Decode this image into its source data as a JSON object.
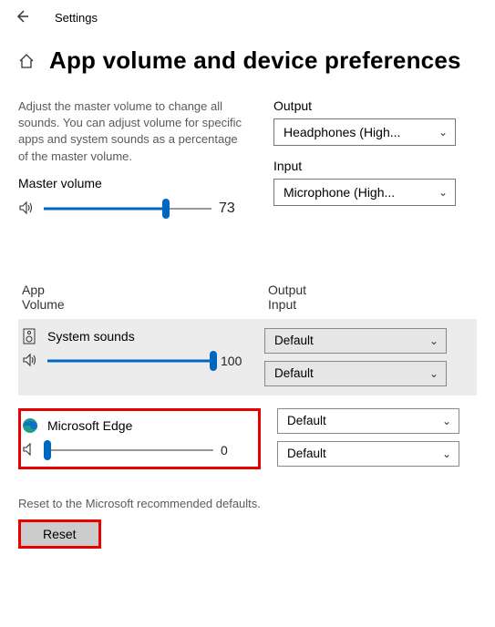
{
  "topbar": {
    "settings": "Settings"
  },
  "page_title": "App volume and device preferences",
  "description": "Adjust the master volume to change all sounds. You can adjust volume for specific apps and system sounds as a percentage of the master volume.",
  "output": {
    "label": "Output",
    "value": "Headphones (High..."
  },
  "input": {
    "label": "Input",
    "value": "Microphone (High..."
  },
  "master": {
    "label": "Master volume",
    "value": "73",
    "percent": 73
  },
  "mixer_header": {
    "left1": "App",
    "left2": "Volume",
    "right1": "Output",
    "right2": "Input"
  },
  "apps": {
    "system": {
      "name": "System sounds",
      "value": "100",
      "percent": 100,
      "output": "Default",
      "input": "Default"
    },
    "edge": {
      "name": "Microsoft Edge",
      "value": "0",
      "percent": 0,
      "output": "Default",
      "input": "Default"
    }
  },
  "reset": {
    "desc": "Reset to the Microsoft recommended defaults.",
    "button": "Reset"
  }
}
